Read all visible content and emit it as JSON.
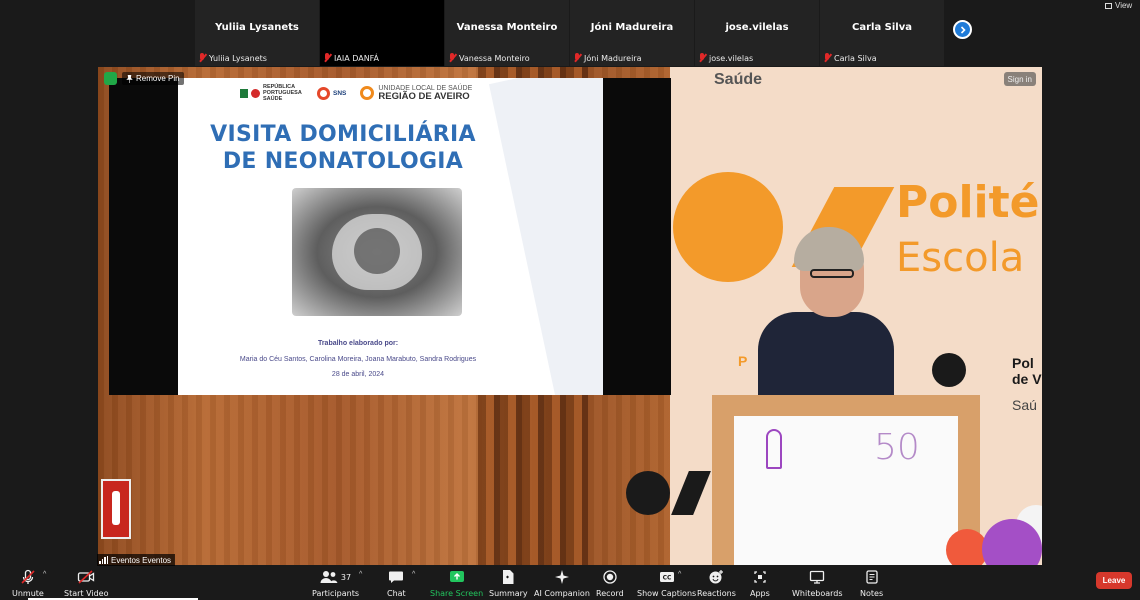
{
  "participants_strip": [
    {
      "display_name": "Yuliia Lysanets",
      "label": "Yuliia Lysanets",
      "muted": true,
      "video": false
    },
    {
      "display_name": "",
      "label": "IAIA DANFÁ",
      "muted": true,
      "video": true
    },
    {
      "display_name": "Vanessa Monteiro",
      "label": "Vanessa Monteiro",
      "muted": true,
      "video": false
    },
    {
      "display_name": "Jóni Madureira",
      "label": "Jóni Madureira",
      "muted": true,
      "video": false
    },
    {
      "display_name": "jose.vilelas",
      "label": "jose.vilelas",
      "muted": true,
      "video": false
    },
    {
      "display_name": "Carla Silva",
      "label": "Carla Silva",
      "muted": true,
      "video": false
    }
  ],
  "view_label": "View",
  "main_video": {
    "remove_pin": "Remove Pin",
    "sign_in": "Sign in",
    "name_tag": "Eventos Eventos"
  },
  "slide": {
    "logo_republica": "REPÚBLICA PORTUGUESA SAÚDE",
    "logo_sns": "SNS",
    "logo_uls_line1": "UNIDADE LOCAL DE SAÚDE",
    "logo_uls_line2": "REGIÃO DE AVEIRO",
    "title_line1": "VISITA DOMICILIÁRIA",
    "title_line2": "DE NEONATOLOGIA",
    "credit_heading": "Trabalho elaborado por:",
    "credit_authors": "Maria do Céu Santos, Carolina Moreira, Joana Marabuto, Sandra Rodrigues",
    "credit_date": "28 de abril, 2024"
  },
  "stage": {
    "brand_top": "Saúde",
    "brand_big_1": "Polité",
    "brand_big_2": "Escola",
    "brand_mid_1": "Pol",
    "brand_mid_2": "de V",
    "brand_mid_3": "Saú",
    "brand_small": "P",
    "podium_number": "50"
  },
  "toolbar": {
    "unmute": "Unmute",
    "start_video": "Start Video",
    "participants": "Participants",
    "participants_count": "37",
    "chat": "Chat",
    "share_screen": "Share Screen",
    "summary": "Summary",
    "ai_companion": "AI Companion",
    "record": "Record",
    "show_captions": "Show Captions",
    "reactions": "Reactions",
    "apps": "Apps",
    "whiteboards": "Whiteboards",
    "notes": "Notes",
    "leave": "Leave"
  },
  "colors": {
    "accent_blue": "#1f7bd8",
    "share_green": "#22c55e",
    "leave_red": "#d6382c",
    "muted_red": "#e02828",
    "slide_title_blue": "#2f6eb5",
    "brand_orange": "#f39a2a"
  }
}
